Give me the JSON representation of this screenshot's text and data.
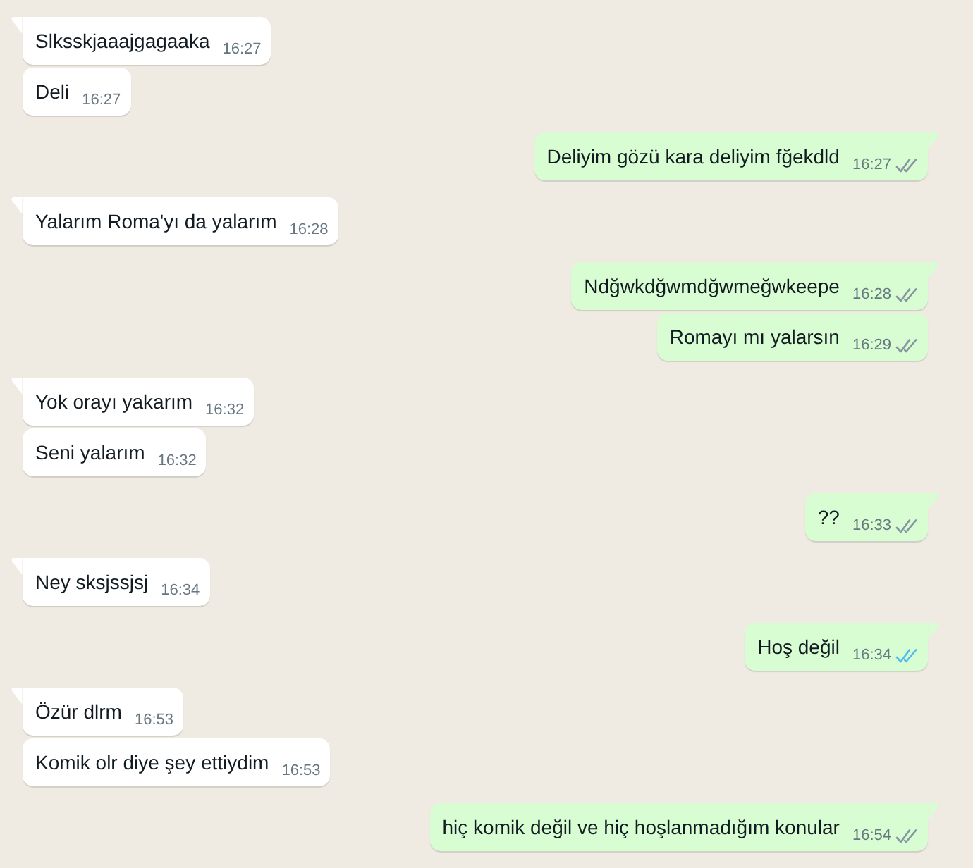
{
  "chat": {
    "groups": [
      {
        "outgoing": false,
        "messages": [
          {
            "text": "Slksskjaaajgagaaka",
            "time": "16:27"
          },
          {
            "text": "Deli",
            "time": "16:27"
          }
        ]
      },
      {
        "outgoing": true,
        "messages": [
          {
            "text": "Deliyim gözü kara deliyim fğekdld",
            "time": "16:27",
            "read": false
          }
        ]
      },
      {
        "outgoing": false,
        "messages": [
          {
            "text": "Yalarım Roma'yı da yalarım",
            "time": "16:28"
          }
        ]
      },
      {
        "outgoing": true,
        "messages": [
          {
            "text": "Ndğwkdğwmdğwmeğwkeepe",
            "time": "16:28",
            "read": false
          },
          {
            "text": "Romayı mı yalarsın",
            "time": "16:29",
            "read": false
          }
        ]
      },
      {
        "outgoing": false,
        "messages": [
          {
            "text": "Yok orayı yakarım",
            "time": "16:32"
          },
          {
            "text": "Seni yalarım",
            "time": "16:32"
          }
        ]
      },
      {
        "outgoing": true,
        "messages": [
          {
            "text": "??",
            "time": "16:33",
            "read": false
          }
        ]
      },
      {
        "outgoing": false,
        "messages": [
          {
            "text": "Ney sksjssjsj",
            "time": "16:34"
          }
        ]
      },
      {
        "outgoing": true,
        "messages": [
          {
            "text": "Hoş değil",
            "time": "16:34",
            "read": true
          }
        ]
      },
      {
        "outgoing": false,
        "messages": [
          {
            "text": "Özür dlrm",
            "time": "16:53"
          },
          {
            "text": "Komik olr diye şey ettiydim",
            "time": "16:53"
          }
        ]
      },
      {
        "outgoing": true,
        "messages": [
          {
            "text": "hiç komik değil ve hiç hoşlanmadığım konular",
            "time": "16:54",
            "read": false
          }
        ]
      }
    ]
  }
}
